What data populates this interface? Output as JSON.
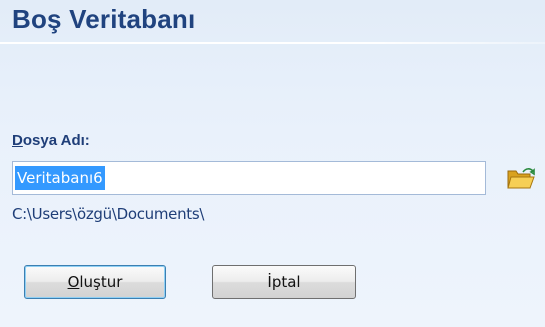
{
  "dialog": {
    "title": "Boş Veritabanı",
    "file_label_accel": "D",
    "file_label_rest": "osya Adı:",
    "file_name_value": "Veritabanı6",
    "path": "C:\\Users\\özgü\\Documents\\",
    "browse_icon": "folder-open-icon",
    "create_accel": "O",
    "create_rest": "luştur",
    "cancel_label": "İptal"
  },
  "colors": {
    "title": "#20437f",
    "label": "#1f3e78",
    "selection": "#3399ff",
    "background": "#e8f0fa"
  }
}
